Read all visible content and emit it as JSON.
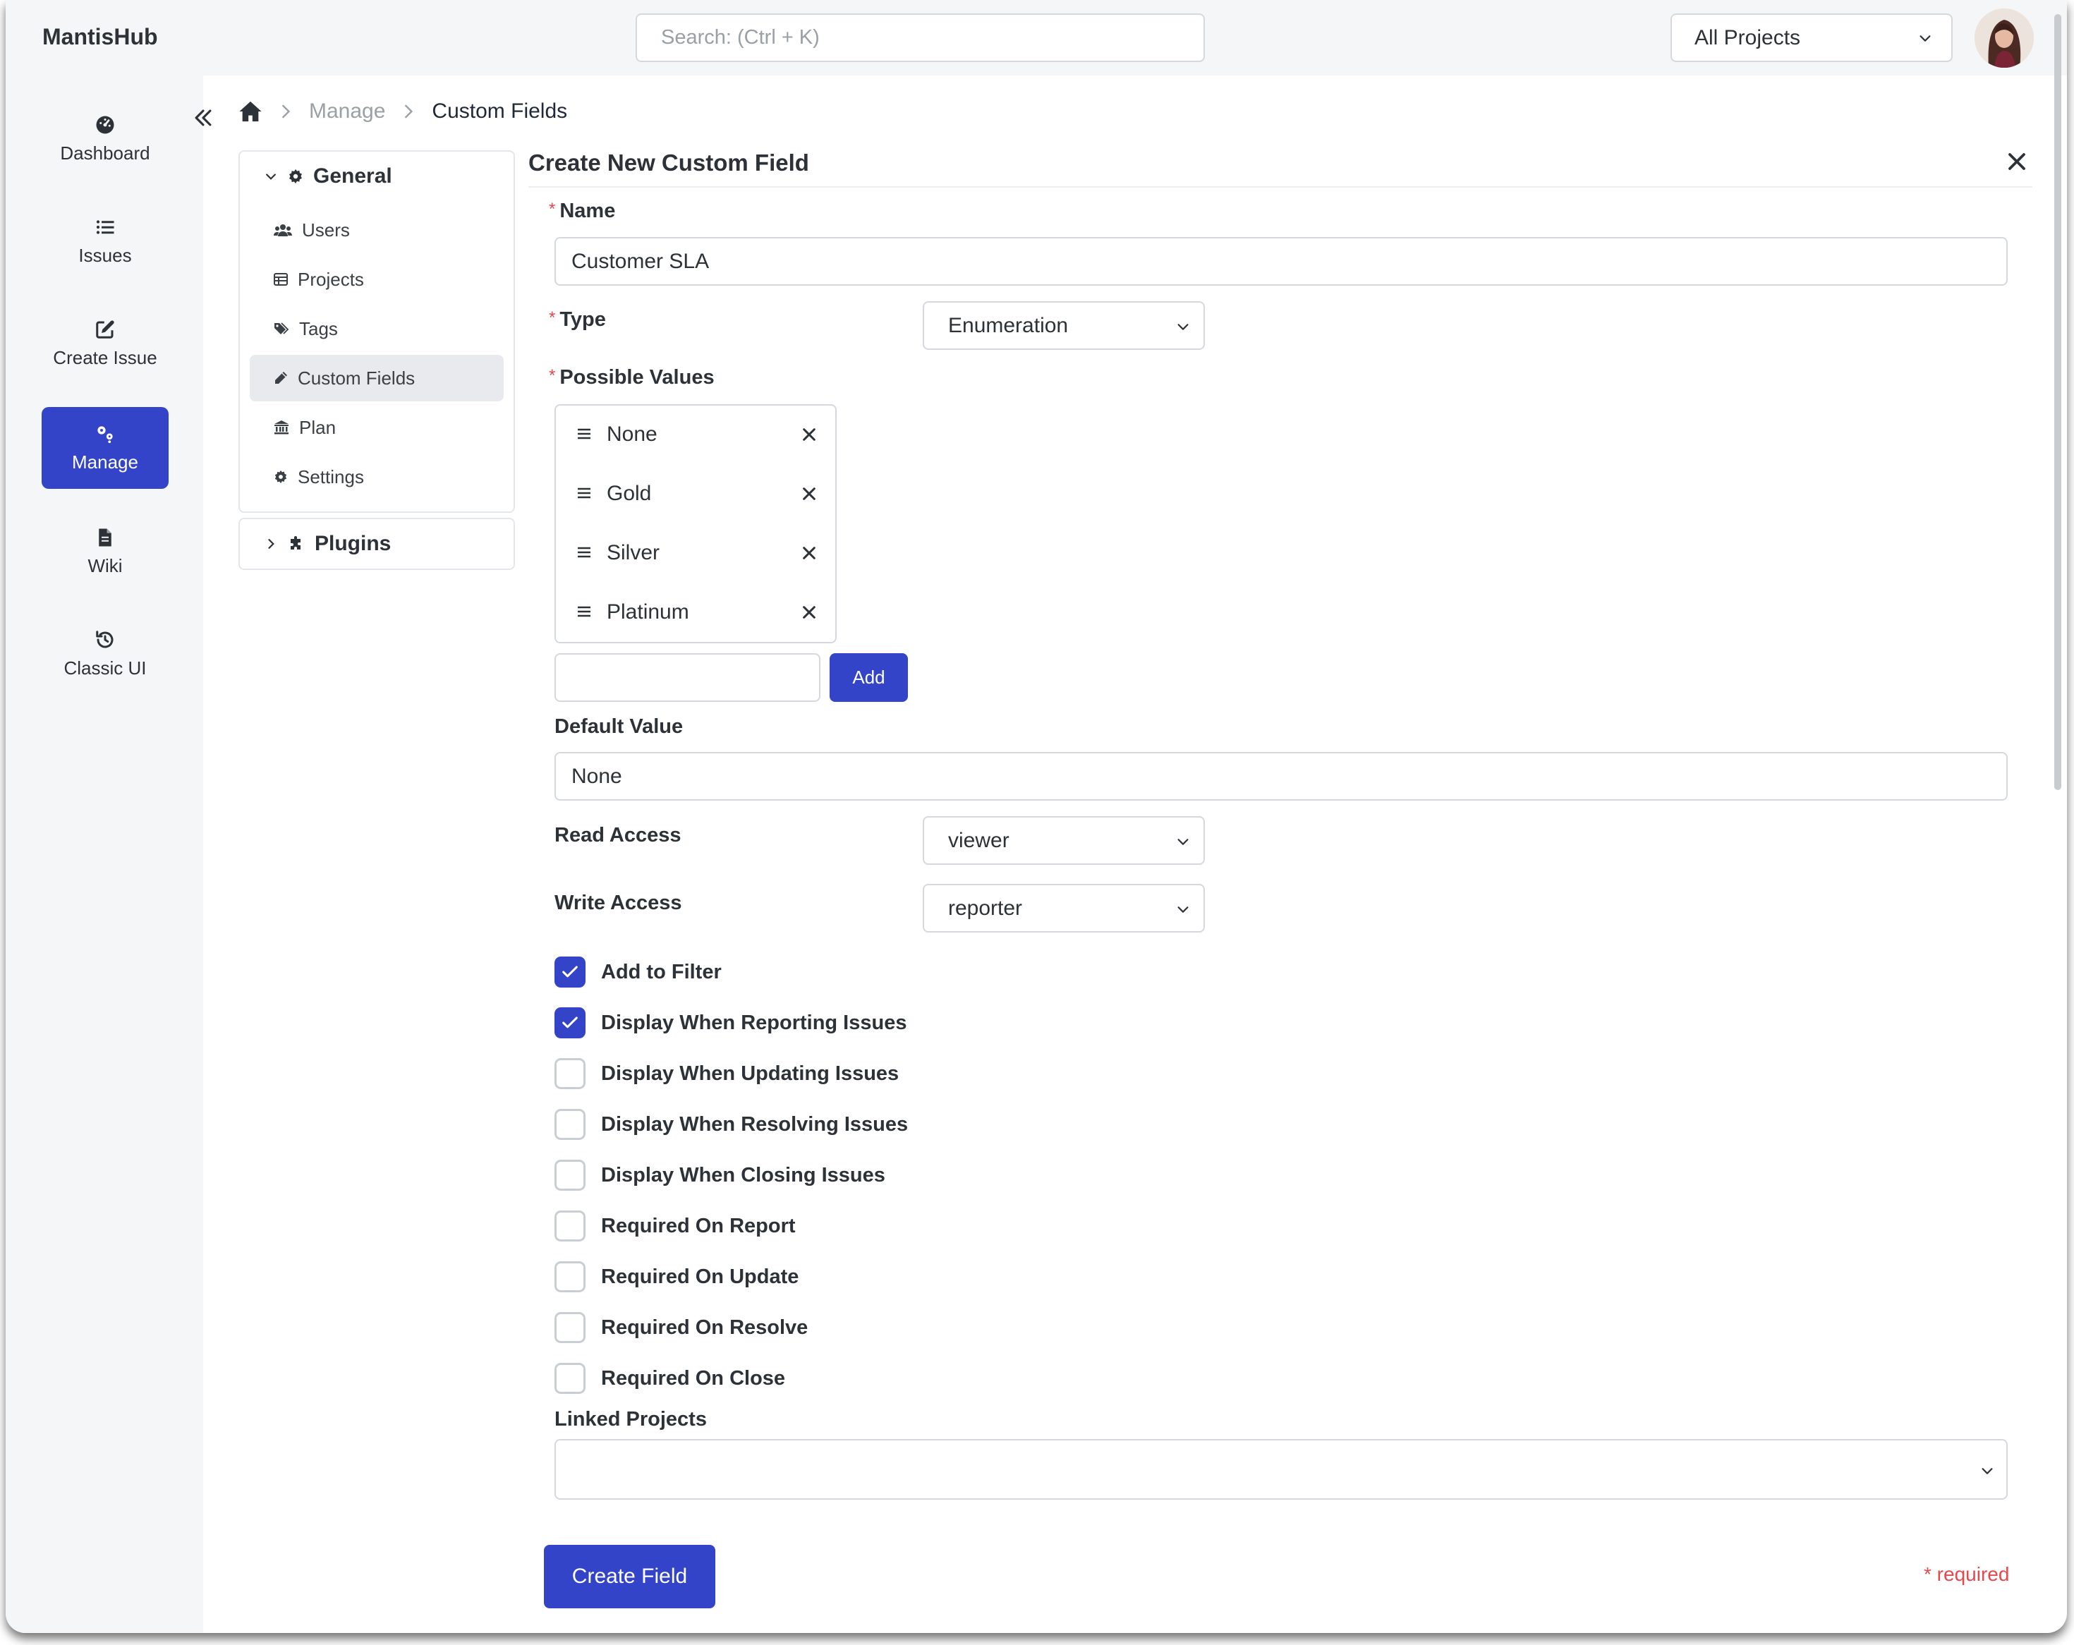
{
  "app": {
    "brand": "MantisHub"
  },
  "search": {
    "placeholder": "Search: (Ctrl + K)"
  },
  "project_selector": {
    "value": "All Projects"
  },
  "nav": {
    "items": [
      {
        "label": "Dashboard",
        "icon": "dashboard-icon"
      },
      {
        "label": "Issues",
        "icon": "list-icon"
      },
      {
        "label": "Create Issue",
        "icon": "edit-icon"
      },
      {
        "label": "Manage",
        "icon": "gears-icon",
        "active": true
      },
      {
        "label": "Wiki",
        "icon": "file-icon"
      },
      {
        "label": "Classic UI",
        "icon": "history-icon"
      }
    ]
  },
  "breadcrumb": {
    "manage": "Manage",
    "current": "Custom Fields"
  },
  "submenu": {
    "general": "General",
    "items": [
      {
        "label": "Users",
        "icon": "users-icon"
      },
      {
        "label": "Projects",
        "icon": "table-icon"
      },
      {
        "label": "Tags",
        "icon": "tags-icon"
      },
      {
        "label": "Custom Fields",
        "icon": "pencil-icon",
        "active": true
      },
      {
        "label": "Plan",
        "icon": "bank-icon"
      },
      {
        "label": "Settings",
        "icon": "gear-icon"
      }
    ],
    "plugins": "Plugins"
  },
  "form": {
    "title": "Create New Custom Field",
    "name_label": "Name",
    "name_value": "Customer SLA",
    "type_label": "Type",
    "type_value": "Enumeration",
    "possible_values_label": "Possible Values",
    "possible_values": [
      "None",
      "Gold",
      "Silver",
      "Platinum"
    ],
    "new_value": "",
    "add_label": "Add",
    "default_value_label": "Default Value",
    "default_value": "None",
    "read_access_label": "Read Access",
    "read_access_value": "viewer",
    "write_access_label": "Write Access",
    "write_access_value": "reporter",
    "checkboxes": [
      {
        "label": "Add to Filter",
        "checked": true
      },
      {
        "label": "Display When Reporting Issues",
        "checked": true
      },
      {
        "label": "Display When Updating Issues",
        "checked": false
      },
      {
        "label": "Display When Resolving Issues",
        "checked": false
      },
      {
        "label": "Display When Closing Issues",
        "checked": false
      },
      {
        "label": "Required On Report",
        "checked": false
      },
      {
        "label": "Required On Update",
        "checked": false
      },
      {
        "label": "Required On Resolve",
        "checked": false
      },
      {
        "label": "Required On Close",
        "checked": false
      }
    ],
    "linked_projects_label": "Linked Projects",
    "create_label": "Create Field",
    "required_note": "* required",
    "required_marker": "*"
  },
  "colors": {
    "accent": "#3344c8",
    "required": "#e5484d"
  }
}
